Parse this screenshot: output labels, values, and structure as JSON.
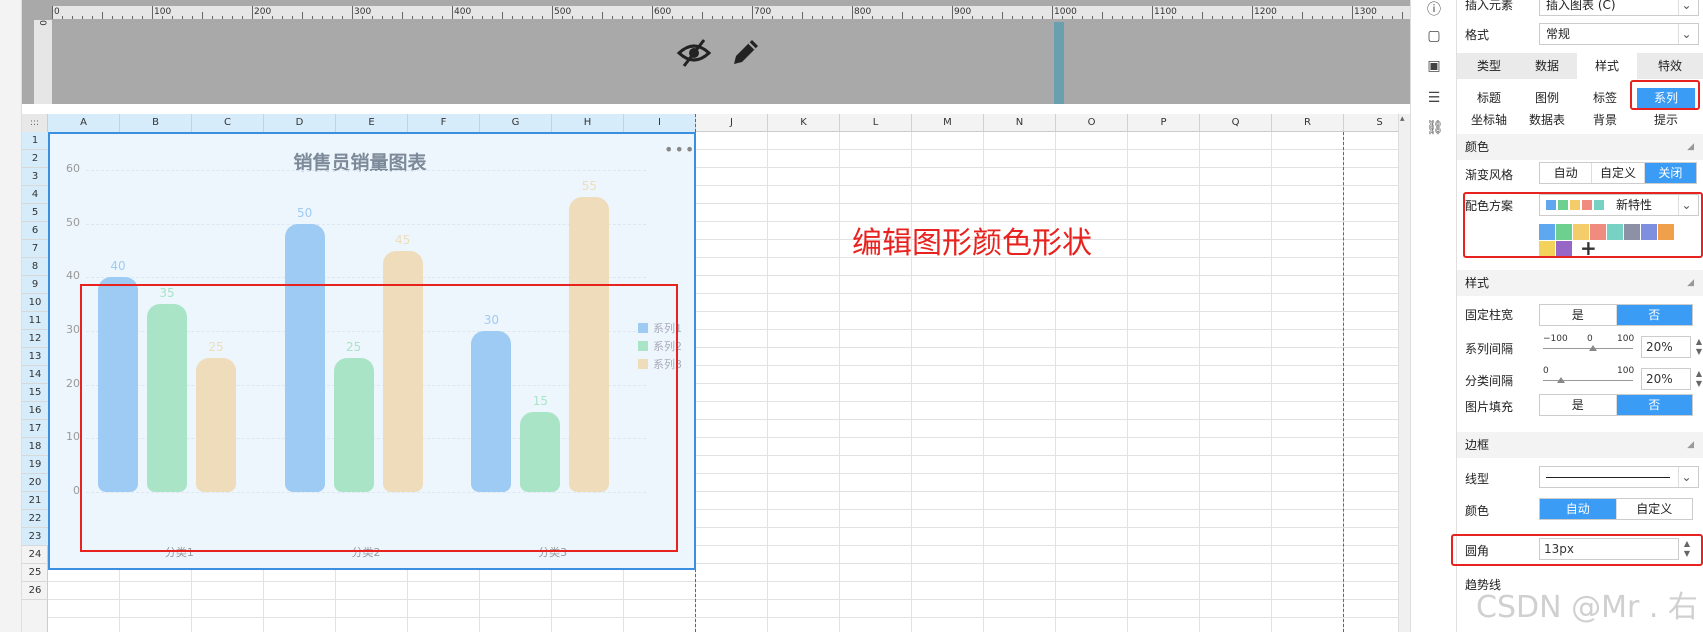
{
  "ruler": {
    "labels": [
      "0",
      "100",
      "200",
      "300",
      "400",
      "500",
      "600",
      "700",
      "800",
      "900",
      "1000",
      "1100",
      "1200",
      "1300"
    ],
    "vlabel": "0"
  },
  "grid": {
    "columns": [
      "A",
      "B",
      "C",
      "D",
      "E",
      "F",
      "G",
      "H",
      "I",
      "J",
      "K",
      "L",
      "M",
      "N",
      "O",
      "P",
      "Q",
      "R",
      "S"
    ],
    "rows": [
      "1",
      "2",
      "3",
      "4",
      "5",
      "6",
      "7",
      "8",
      "9",
      "10",
      "11",
      "12",
      "13",
      "14",
      "15",
      "16",
      "17",
      "18",
      "19",
      "20",
      "21",
      "22",
      "23",
      "24",
      "25",
      "26"
    ],
    "corner": ":::"
  },
  "chart_data": {
    "type": "bar",
    "title": "销售员销量图表",
    "categories": [
      "分类1",
      "分类2",
      "分类3"
    ],
    "series": [
      {
        "name": "系列1",
        "values": [
          40,
          50,
          30
        ],
        "color": "#9ecbf3"
      },
      {
        "name": "系列2",
        "values": [
          35,
          25,
          15
        ],
        "color": "#a9e4c7"
      },
      {
        "name": "系列3",
        "values": [
          25,
          45,
          55
        ],
        "color": "#eedcbb"
      }
    ],
    "ylim": [
      0,
      60
    ],
    "yticks": [
      0,
      10,
      20,
      30,
      40,
      50,
      60
    ],
    "ytick_labels": [
      "0",
      "10",
      "20",
      "30",
      "40",
      "50",
      "60"
    ],
    "legend": "right",
    "grid": true,
    "more_glyph": "•••"
  },
  "annotation": "编辑图形颜色形状",
  "toolbar": {
    "icons": [
      "info-icon",
      "crop-icon",
      "dropdown-box-icon",
      "stack-icon",
      "link-icon"
    ]
  },
  "panel": {
    "insert_label": "插入元素",
    "insert_value": "插入图表 (C)",
    "format_label": "格式",
    "format_value": "常规",
    "tabs": [
      "类型",
      "数据",
      "样式",
      "特效"
    ],
    "subtabs_row1": [
      "标题",
      "图例",
      "标签",
      "系列"
    ],
    "subtabs_row2": [
      "坐标轴",
      "数据表",
      "背景",
      "提示"
    ],
    "color_section": "颜色",
    "gradient_label": "渐变风格",
    "gradient_options": [
      "自动",
      "自定义",
      "关闭"
    ],
    "scheme_label": "配色方案",
    "scheme_value": "新特性",
    "palette": [
      "#5fa8ef",
      "#6dd08e",
      "#f5cc6a",
      "#f08b7f",
      "#77d2c4",
      "#8c91a6",
      "#7e8fe0",
      "#f0a04b",
      "#f2d25a",
      "#9767c7"
    ],
    "add_glyph": "+",
    "style_section": "样式",
    "fixed_width_label": "固定柱宽",
    "fixed_width_options": [
      "是",
      "否"
    ],
    "series_gap_label": "系列间隔",
    "series_gap_slider": {
      "min": "−100",
      "mid": "0",
      "max": "100",
      "pos": 0.55
    },
    "series_gap_value": "20%",
    "cat_gap_label": "分类间隔",
    "cat_gap_slider": {
      "min": "0",
      "max": "100",
      "pos": 0.2
    },
    "cat_gap_value": "20%",
    "image_fill_label": "图片填充",
    "image_fill_options": [
      "是",
      "否"
    ],
    "border_section": "边框",
    "line_type_label": "线型",
    "border_color_label": "颜色",
    "border_color_options": [
      "自动",
      "自定义"
    ],
    "radius_label": "圆角",
    "radius_value": "13px",
    "trend_label": "趋势线",
    "accent": "#3b9cf5"
  },
  "watermark": "CSDN @Mr . 右"
}
